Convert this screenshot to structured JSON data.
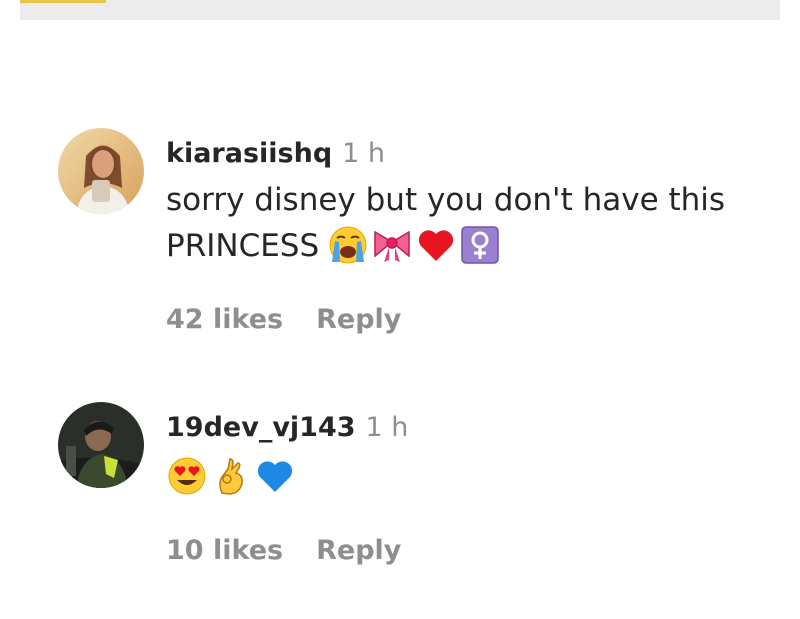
{
  "comments": [
    {
      "username": "kiarasiishq",
      "time": "1 h",
      "text_line1": "sorry disney but you don't have this",
      "text_line2": "PRINCESS",
      "emojis": [
        "loudly-crying-face",
        "ribbon",
        "red-heart",
        "female-sign"
      ],
      "likes": "42 likes",
      "reply_label": "Reply"
    },
    {
      "username": "19dev_vj143",
      "time": "1 h",
      "emojis": [
        "heart-eyes-face",
        "ok-hand",
        "blue-heart"
      ],
      "likes": "10 likes",
      "reply_label": "Reply"
    }
  ],
  "colors": {
    "username": "#262626",
    "secondary": "#8e8e8e",
    "topbar": "#ececec",
    "accent": "#e8c547"
  }
}
